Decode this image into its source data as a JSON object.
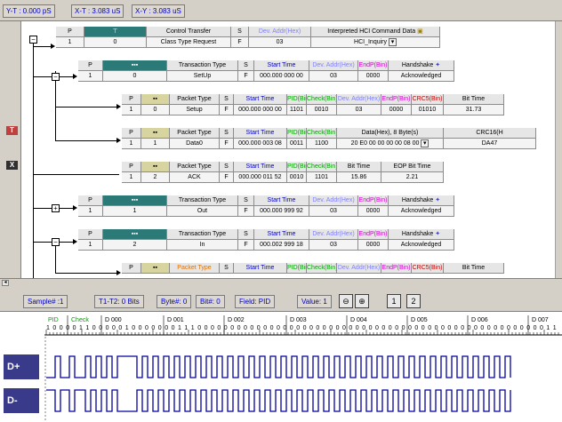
{
  "toolbar": {
    "yt": "Y-T : 0.000 pS",
    "xt": "X-T : 3.083 uS",
    "xy": "X-Y : 3.083 uS"
  },
  "control": {
    "hdr": [
      "P",
      "",
      "Control Transfer",
      "S",
      "Dev. Addr(Hex)",
      "Interpreted HCI Command Data"
    ],
    "row": [
      "1",
      "0",
      "Class Type Request",
      "F",
      "03",
      "HCI_Inquiry"
    ]
  },
  "setup_txn": {
    "hdr": [
      "P",
      "",
      "Transaction Type",
      "S",
      "Start Time",
      "Dev. Addr(Hex)",
      "EndP(Bin)",
      "Handshake"
    ],
    "row": [
      "1",
      "0",
      "SetUp",
      "F",
      "000.000 000 00",
      "03",
      "0000",
      "Acknowledged"
    ]
  },
  "setup_pkt": {
    "hdr": [
      "P",
      "",
      "Packet Type",
      "S",
      "Start Time",
      "PID(Bin)",
      "Check(Bin)",
      "Dev. Addr(Hex)",
      "EndP(Bin)",
      "CRC5(Bin)",
      "Bit Time"
    ],
    "row": [
      "1",
      "0",
      "Setup",
      "F",
      "000.000 000 00",
      "1101",
      "0010",
      "03",
      "0000",
      "01010",
      "31.73"
    ]
  },
  "data_pkt": {
    "hdr": [
      "P",
      "",
      "Packet Type",
      "S",
      "Start Time",
      "PID(Bin)",
      "Check(Bin)",
      "Data(Hex), 8 Byte(s)",
      "CRC16(H"
    ],
    "row": [
      "1",
      "1",
      "Data0",
      "F",
      "000.000 003 08",
      "0011",
      "1100",
      "20 E0 00 00 00 00 08 00",
      "DA47"
    ]
  },
  "ack_pkt": {
    "hdr": [
      "P",
      "",
      "Packet Type",
      "S",
      "Start Time",
      "PID(Bin)",
      "Check(Bin)",
      "Bit Time",
      "EOP Bit Time"
    ],
    "row": [
      "1",
      "2",
      "ACK",
      "F",
      "000.000 011 52",
      "0010",
      "1101",
      "15.86",
      "2.21"
    ]
  },
  "out_txn": {
    "hdr": [
      "P",
      "",
      "Transaction Type",
      "S",
      "Start Time",
      "Dev. Addr(Hex)",
      "EndP(Bin)",
      "Handshake"
    ],
    "row": [
      "1",
      "1",
      "Out",
      "F",
      "000.000 999 92",
      "03",
      "0000",
      "Acknowledged"
    ]
  },
  "in_txn": {
    "hdr": [
      "P",
      "",
      "Transaction Type",
      "S",
      "Start Time",
      "Dev. Addr(Hex)",
      "EndP(Bin)",
      "Handshake"
    ],
    "row": [
      "1",
      "2",
      "In",
      "F",
      "000.002 999 18",
      "03",
      "0000",
      "Acknowledged"
    ]
  },
  "last_pkt": {
    "hdr": [
      "P",
      "",
      "Packet Type",
      "S",
      "Start Time",
      "PID(Bin)",
      "Check(Bin)",
      "Dev. Addr(Hex)",
      "EndP(Bin)",
      "CRC5(Bin)",
      "Bit Time"
    ]
  },
  "bottom": {
    "sample": "Sample# :1",
    "t1t2": "T1-T2: 0 Bits",
    "byte": "Byte#: 0",
    "bit": "Bit#: 0",
    "field": "Field: PID",
    "value": "Value: 1"
  },
  "wave": {
    "field_labels": [
      "PID",
      "Check",
      "D 000",
      "D 001",
      "D 002",
      "D 003",
      "D 004",
      "D 005",
      "D 006",
      "D 007"
    ],
    "bits": "1 0 0 0 0 1 1 0 0 0 0 0 1 0 0 0 0 0 0 0 1 1 1 0 0 0 0 0 0 0 0 0 0 0 0 0 0 0 0 0 0 0 0 0 0 0 0 0 0 0 0 0 0 0 0 0 0 0 0 0 0 0 0 0 0 0 0 0 0 0 0 0 0 0 0 0 1 1",
    "dplus": "D+",
    "dminus": "D-"
  },
  "colors": {
    "teal": "#2b7a78",
    "blue_text": "#0000d0",
    "pid_green": "#00a000",
    "endp_pink": "#d000d0"
  }
}
